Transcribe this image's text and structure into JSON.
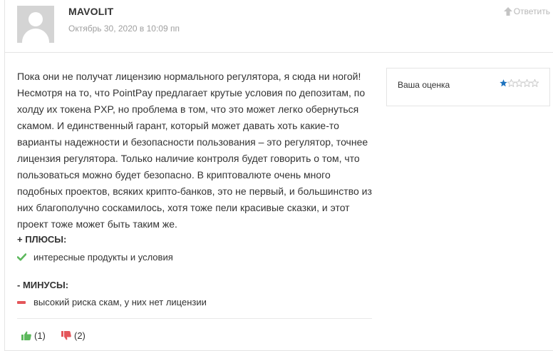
{
  "comment": {
    "author": "MAVOLIT",
    "date": "Октябрь 30, 2020 в 10:09 пп",
    "reply_label": "Ответить",
    "text": "Пока они не получат лицензию нормального регулятора, я сюда ни ногой! Несмотря на то, что PointPay предлагает крутые условия по депозитам, по холду их токена PXP, но проблема в том, что это может легко обернуться скамом. И единственный гарант, который может давать хоть какие-то варианты надежности и безопасности пользования – это регулятор, точнее лицензия регулятора. Только наличие контроля будет говорить о том, что пользоваться можно будет безопасно. В криптовалюте очень много подобных проектов, всяких крипто-банков, это не первый, и большинство из них благополучно соскамилось, хотя тоже пели красивые сказки, и этот проект тоже может быть таким же.",
    "pros": {
      "title": "+ ПЛЮСЫ:",
      "items": [
        "интересные продукты и условия"
      ]
    },
    "cons": {
      "title": "- МИНУСЫ:",
      "items": [
        "высокий риска скам, у них нет лицензии"
      ]
    },
    "votes": {
      "up": "(1)",
      "down": "(2)"
    }
  },
  "rating": {
    "label": "Ваша оценка",
    "value": 1,
    "max": 5
  },
  "colors": {
    "accent_blue": "#1e73be",
    "star_empty": "#c8c8c8",
    "pro_green": "#5cb85c",
    "con_red": "#e4565a",
    "muted_text": "#a0a0a0"
  }
}
